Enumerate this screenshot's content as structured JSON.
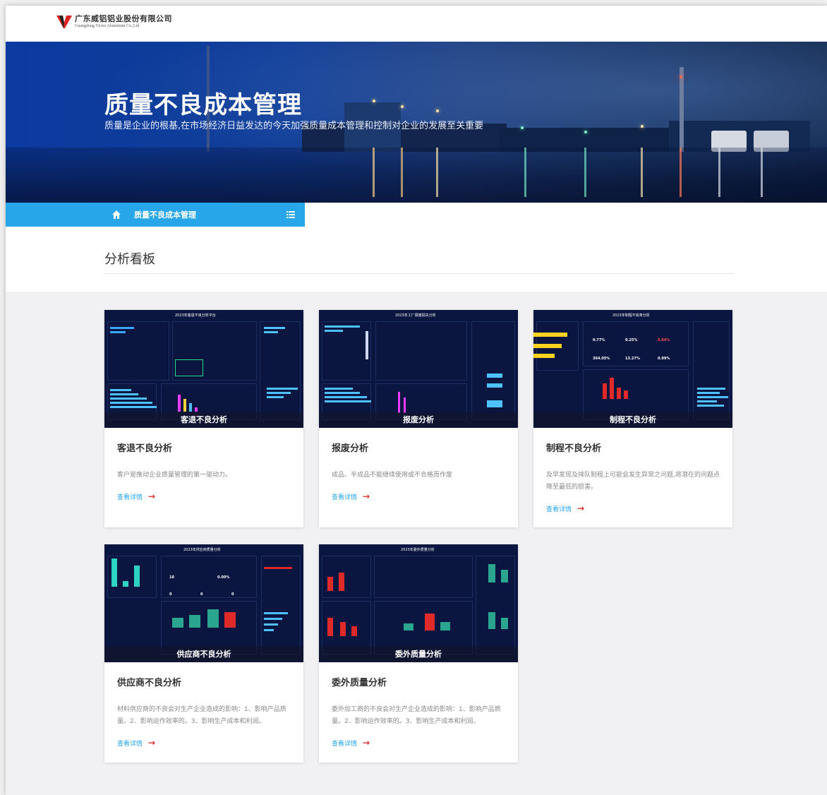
{
  "company": {
    "name_cn": "广东威铝铝业股份有限公司",
    "name_en": "Guangdong Victor Aluminum Co.,Ltd"
  },
  "banner": {
    "title": "质量不良成本管理",
    "subtitle": "质量是企业的根基,在市场经济日益发达的今天加强质量成本管理和控制对企业的发展至关重要"
  },
  "breadcrumb": {
    "current": "质量不良成本管理"
  },
  "section": {
    "title": "分析看板"
  },
  "colors": {
    "accent": "#27a6ea",
    "arrow": "#e02a2a",
    "banner": "#0b3aa0"
  },
  "cards": [
    {
      "caption": "客退不良分析",
      "title": "客退不良分析",
      "desc": "客户是推动企业质量管理的第一驱动力。",
      "link": "查看详情",
      "header": "2023年客退不良分析平台"
    },
    {
      "caption": "报废分析",
      "title": "报废分析",
      "desc": "成品、半成品不能继续使用或不合格而作废",
      "link": "查看详情",
      "header": "2023年工厂报废损失分析"
    },
    {
      "caption": "制程不良分析",
      "title": "制程不良分析",
      "desc": "及早发现及排队制程上可能会发生异常之问题,将潜在的问题点降至最低的损害。",
      "link": "查看详情",
      "header": "2023年制程不良率分析",
      "kpis": [
        "0.77%",
        "0.25%",
        "0.84%",
        "364.05%",
        "13.27%",
        "0.99%"
      ]
    },
    {
      "caption": "供应商不良分析",
      "title": "供应商不良分析",
      "desc": "材料供应商的不良会对生产企业造成的影响：1、影响产品质量。2、影响运作效率的。3、影响生产成本和利润。",
      "link": "查看详情",
      "header": "2023年供应商质量分析",
      "kpis": [
        "10",
        "0.00%",
        "0",
        "0",
        "0"
      ]
    },
    {
      "caption": "委外质量分析",
      "title": "委外质量分析",
      "desc": "委外加工商的不良会对生产企业造成的影响：1、影响产品质量。2、影响运作效率的。3、影响生产成本和利润。",
      "link": "查看详情",
      "header": "2023年委外质量分析"
    }
  ]
}
